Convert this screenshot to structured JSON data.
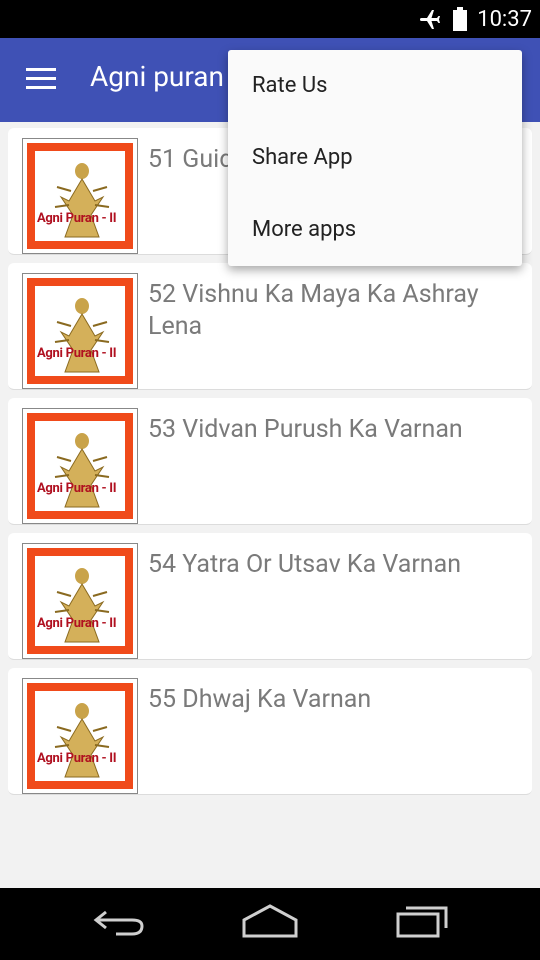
{
  "status_bar": {
    "time": "10:37",
    "icons": [
      "airplane-mode-icon",
      "battery-icon"
    ]
  },
  "app_bar": {
    "title": "Agni puran",
    "menu_icon": "hamburger-menu-icon",
    "color": "#3f51b5"
  },
  "list": {
    "thumbnail_caption": "Agni Puran - II",
    "items": [
      {
        "title": "51 Guid"
      },
      {
        "title": "52 Vishnu Ka Maya Ka Ashray Lena"
      },
      {
        "title": "53 Vidvan Purush Ka Varnan"
      },
      {
        "title": "54 Yatra Or Utsav Ka Varnan"
      },
      {
        "title": "55 Dhwaj Ka Varnan"
      }
    ]
  },
  "overflow_menu": {
    "items": [
      {
        "label": "Rate Us"
      },
      {
        "label": "Share App"
      },
      {
        "label": "More apps"
      }
    ]
  },
  "nav_bar": {
    "buttons": [
      "back-icon",
      "home-icon",
      "recent-apps-icon"
    ]
  },
  "colors": {
    "thumb_border": "#f04a1a",
    "caption": "#b01020"
  }
}
